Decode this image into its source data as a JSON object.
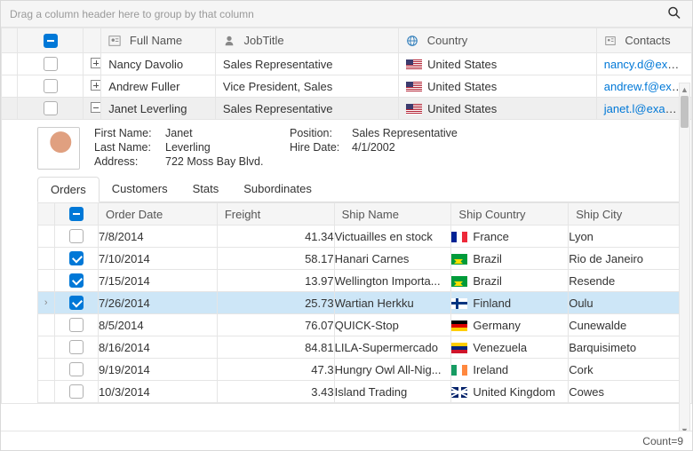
{
  "group_panel_hint": "Drag a column header here to group by that column",
  "master_headers": {
    "name": "Full Name",
    "job": "JobTitle",
    "country": "Country",
    "contacts": "Contacts"
  },
  "master_rows": [
    {
      "name": "Nancy Davolio",
      "job": "Sales Representative",
      "country": "United States",
      "contact": "nancy.d@exampl",
      "expanded": false
    },
    {
      "name": "Andrew Fuller",
      "job": "Vice President, Sales",
      "country": "United States",
      "contact": "andrew.f@examp",
      "expanded": false
    },
    {
      "name": "Janet Leverling",
      "job": "Sales Representative",
      "country": "United States",
      "contact": "janet.l@example.",
      "expanded": true
    }
  ],
  "detail": {
    "labels": {
      "first": "First Name:",
      "last": "Last Name:",
      "addr": "Address:",
      "pos": "Position:",
      "hire": "Hire Date:"
    },
    "first": "Janet",
    "last": "Leverling",
    "addr": "722 Moss Bay Blvd.",
    "pos": "Sales Representative",
    "hire": "4/1/2002"
  },
  "tabs": [
    "Orders",
    "Customers",
    "Stats",
    "Subordinates"
  ],
  "sub_headers": {
    "date": "Order Date",
    "freight": "Freight",
    "ship": "Ship Name",
    "country": "Ship Country",
    "city": "Ship City"
  },
  "orders": [
    {
      "sel": false,
      "date": "7/8/2014",
      "freight": "41.34",
      "ship": "Victuailles en stock",
      "flag": "fr",
      "country": "France",
      "city": "Lyon"
    },
    {
      "sel": true,
      "date": "7/10/2014",
      "freight": "58.17",
      "ship": "Hanari Carnes",
      "flag": "br",
      "country": "Brazil",
      "city": "Rio de Janeiro"
    },
    {
      "sel": true,
      "date": "7/15/2014",
      "freight": "13.97",
      "ship": "Wellington Importa...",
      "flag": "br",
      "country": "Brazil",
      "city": "Resende"
    },
    {
      "sel": true,
      "date": "7/26/2014",
      "freight": "25.73",
      "ship": "Wartian Herkku",
      "flag": "fi",
      "country": "Finland",
      "city": "Oulu",
      "hl": true,
      "indicator": true
    },
    {
      "sel": false,
      "date": "8/5/2014",
      "freight": "76.07",
      "ship": "QUICK-Stop",
      "flag": "de",
      "country": "Germany",
      "city": "Cunewalde"
    },
    {
      "sel": false,
      "date": "8/16/2014",
      "freight": "84.81",
      "ship": "LILA-Supermercado",
      "flag": "ve",
      "country": "Venezuela",
      "city": "Barquisimeto"
    },
    {
      "sel": false,
      "date": "9/19/2014",
      "freight": "47.3",
      "ship": "Hungry Owl All-Nig...",
      "flag": "ie",
      "country": "Ireland",
      "city": "Cork"
    },
    {
      "sel": false,
      "date": "10/3/2014",
      "freight": "3.43",
      "ship": "Island Trading",
      "flag": "gb",
      "country": "United Kingdom",
      "city": "Cowes"
    }
  ],
  "footer_count": "Count=9"
}
